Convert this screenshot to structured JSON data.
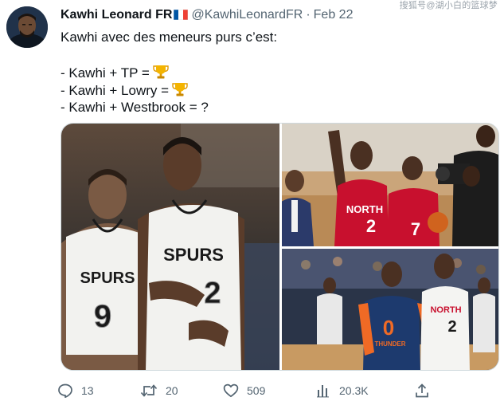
{
  "watermark": "搜狐号@湖小白的篮球梦",
  "tweet": {
    "author_name": "Kawhi Leonard FR",
    "author_handle": "@KawhiLeonardFR",
    "separator": "·",
    "date": "Feb 22",
    "lines": [
      "Kawhi avec des meneurs purs c’est:",
      "",
      "- Kawhi + TP =",
      "- Kawhi + Lowry =",
      "- Kawhi + Westbrook = ?"
    ],
    "icons": {
      "flag": "france-flag-icon",
      "trophy": "trophy-icon"
    }
  },
  "media": {
    "left_photo": {
      "jersey_left_team": "SPURS",
      "jersey_left_number": "9",
      "jersey_right_team": "SPURS",
      "jersey_right_number": "2"
    },
    "top_right_photo": {
      "jersey_left_team": "NORTH",
      "jersey_left_number": "2",
      "jersey_right_number": "7"
    },
    "bottom_right_photo": {
      "jersey_left_number": "0",
      "jersey_left_team": "THUNDER",
      "jersey_right_team": "NORTH",
      "jersey_right_number": "2"
    }
  },
  "actions": {
    "replies": "13",
    "retweets": "20",
    "likes": "509",
    "views": "20.3K"
  },
  "colors": {
    "text": "#0f1419",
    "muted": "#536471",
    "border": "#cfd9de",
    "spurs_white": "#f2f2ef",
    "raptors_red": "#c8102e",
    "thunder_blue": "#1d3a6e",
    "thunder_orange": "#ef6a25"
  }
}
